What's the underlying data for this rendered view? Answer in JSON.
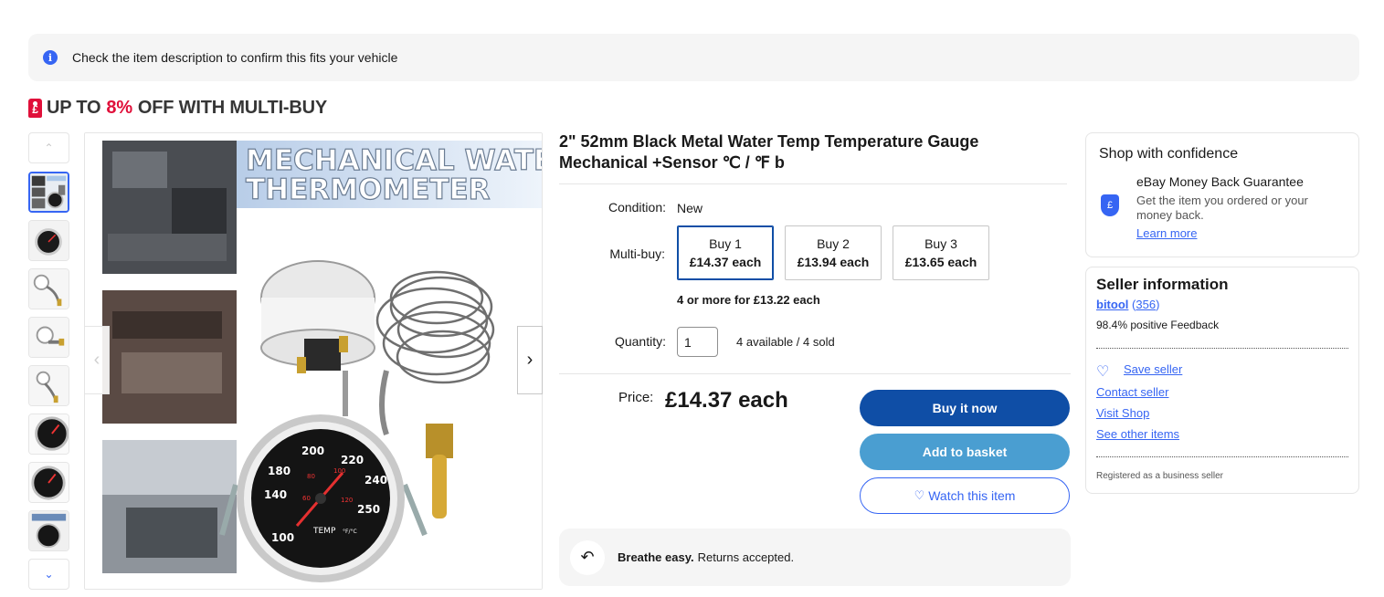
{
  "banner": {
    "text": "Check the item description to confirm this fits your vehicle"
  },
  "promo": {
    "prefix": "UP TO",
    "percent": "8%",
    "suffix": "OFF WITH MULTI-BUY",
    "tag_symbol": "£"
  },
  "gallery": {
    "thumbnail_count": 8,
    "selected_index": 0,
    "main_image": {
      "banner_text_1": "MECHANICAL WATER",
      "banner_text_2": "THERMOMETER",
      "gauge_ticks": [
        "100",
        "140",
        "180",
        "200",
        "220",
        "240",
        "250",
        "120",
        "80",
        "100",
        "60"
      ],
      "gauge_label": "TEMP",
      "gauge_unit": "°F/°C"
    }
  },
  "product": {
    "title": "2\" 52mm Black Metal Water Temp Temperature Gauge Mechanical +Sensor ℃ / ℉ b",
    "condition_label": "Condition:",
    "condition_value": "New",
    "multibuy_label": "Multi-buy:",
    "multibuy_options": [
      {
        "qty": "Buy 1",
        "price": "£14.37 each",
        "selected": true
      },
      {
        "qty": "Buy 2",
        "price": "£13.94 each",
        "selected": false
      },
      {
        "qty": "Buy 3",
        "price": "£13.65 each",
        "selected": false
      }
    ],
    "multibuy_more": "4 or more for £13.22 each",
    "quantity_label": "Quantity:",
    "quantity_value": "1",
    "availability": "4 available / 4 sold",
    "price_label": "Price:",
    "price_value": "£14.37 each"
  },
  "actions": {
    "buy_now": "Buy it now",
    "add_to_basket": "Add to basket",
    "watch": "Watch this item"
  },
  "returns": {
    "bold": "Breathe easy.",
    "text": "Returns accepted."
  },
  "confidence": {
    "heading": "Shop with confidence",
    "guarantee_title": "eBay Money Back Guarantee",
    "guarantee_desc": "Get the item you ordered or your money back.",
    "learn_more": "Learn more"
  },
  "seller": {
    "heading": "Seller information",
    "name": "bitool",
    "feedback_count": "356",
    "feedback_pct": "98.4% positive Feedback",
    "save_seller": "Save seller",
    "contact": "Contact seller",
    "visit_shop": "Visit Shop",
    "other_items": "See other items",
    "business_note": "Registered as a business seller"
  },
  "colors": {
    "accent": "#3665f3",
    "buy_now": "#0f4ea6",
    "basket": "#4a9ed1",
    "promo_red": "#e0103a"
  },
  "icons": {
    "banner": "info-icon",
    "promo": "price-tag-icon",
    "thumb_up": "chevron-up-icon",
    "thumb_down": "chevron-down-icon",
    "img_prev": "chevron-left-icon",
    "img_next": "chevron-right-icon",
    "watch": "heart-icon",
    "returns": "return-arrow-icon",
    "guarantee": "shield-icon",
    "save_seller": "heart-outline-icon"
  }
}
